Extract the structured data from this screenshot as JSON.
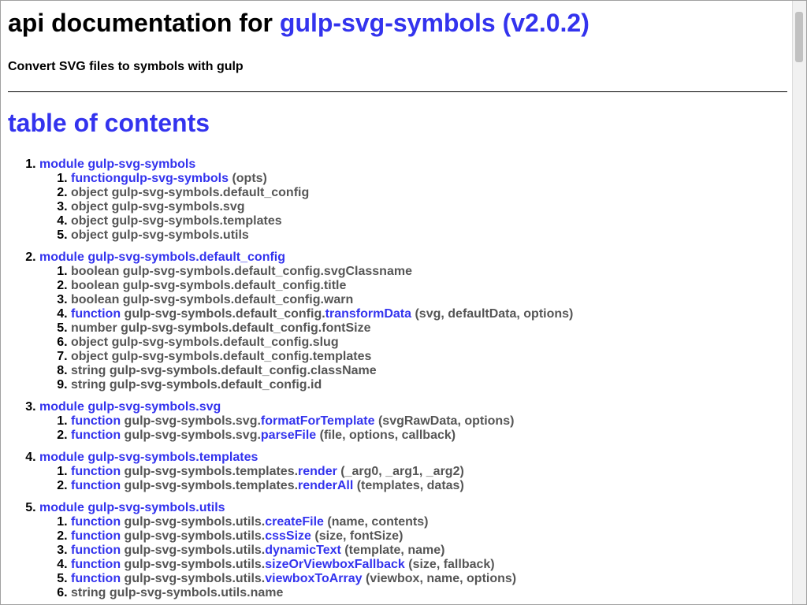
{
  "header": {
    "title_prefix": "api documentation for",
    "title_link": "gulp-svg-symbols (v2.0.2)",
    "subtitle": "Convert SVG files to symbols with gulp"
  },
  "toc": {
    "heading": "table of contents",
    "modules": [
      {
        "label": "module gulp-svg-symbols",
        "items": [
          {
            "type": "function",
            "prefix": "",
            "name": "gulp-svg-symbols",
            "args": " (opts)"
          },
          {
            "type": "",
            "prefix": "object gulp-svg-symbols.default_config",
            "name": "",
            "args": ""
          },
          {
            "type": "",
            "prefix": "object gulp-svg-symbols.svg",
            "name": "",
            "args": ""
          },
          {
            "type": "",
            "prefix": "object gulp-svg-symbols.templates",
            "name": "",
            "args": ""
          },
          {
            "type": "",
            "prefix": "object gulp-svg-symbols.utils",
            "name": "",
            "args": ""
          }
        ]
      },
      {
        "label": "module gulp-svg-symbols.default_config",
        "items": [
          {
            "type": "",
            "prefix": "boolean gulp-svg-symbols.default_config.svgClassname",
            "name": "",
            "args": ""
          },
          {
            "type": "",
            "prefix": "boolean gulp-svg-symbols.default_config.title",
            "name": "",
            "args": ""
          },
          {
            "type": "",
            "prefix": "boolean gulp-svg-symbols.default_config.warn",
            "name": "",
            "args": ""
          },
          {
            "type": "function",
            "prefix": " gulp-svg-symbols.default_config.",
            "name": "transformData",
            "args": " (svg, defaultData, options)"
          },
          {
            "type": "",
            "prefix": "number gulp-svg-symbols.default_config.fontSize",
            "name": "",
            "args": ""
          },
          {
            "type": "",
            "prefix": "object gulp-svg-symbols.default_config.slug",
            "name": "",
            "args": ""
          },
          {
            "type": "",
            "prefix": "object gulp-svg-symbols.default_config.templates",
            "name": "",
            "args": ""
          },
          {
            "type": "",
            "prefix": "string gulp-svg-symbols.default_config.className",
            "name": "",
            "args": ""
          },
          {
            "type": "",
            "prefix": "string gulp-svg-symbols.default_config.id",
            "name": "",
            "args": ""
          }
        ]
      },
      {
        "label": "module gulp-svg-symbols.svg",
        "items": [
          {
            "type": "function",
            "prefix": " gulp-svg-symbols.svg.",
            "name": "formatForTemplate",
            "args": " (svgRawData, options)"
          },
          {
            "type": "function",
            "prefix": " gulp-svg-symbols.svg.",
            "name": "parseFile",
            "args": " (file, options, callback)"
          }
        ]
      },
      {
        "label": "module gulp-svg-symbols.templates",
        "items": [
          {
            "type": "function",
            "prefix": " gulp-svg-symbols.templates.",
            "name": "render",
            "args": " (_arg0, _arg1, _arg2)"
          },
          {
            "type": "function",
            "prefix": " gulp-svg-symbols.templates.",
            "name": "renderAll",
            "args": " (templates, datas)"
          }
        ]
      },
      {
        "label": "module gulp-svg-symbols.utils",
        "items": [
          {
            "type": "function",
            "prefix": " gulp-svg-symbols.utils.",
            "name": "createFile",
            "args": " (name, contents)"
          },
          {
            "type": "function",
            "prefix": " gulp-svg-symbols.utils.",
            "name": "cssSize",
            "args": " (size, fontSize)"
          },
          {
            "type": "function",
            "prefix": " gulp-svg-symbols.utils.",
            "name": "dynamicText",
            "args": " (template, name)"
          },
          {
            "type": "function",
            "prefix": " gulp-svg-symbols.utils.",
            "name": "sizeOrViewboxFallback",
            "args": " (size, fallback)"
          },
          {
            "type": "function",
            "prefix": " gulp-svg-symbols.utils.",
            "name": "viewboxToArray",
            "args": " (viewbox, name, options)"
          },
          {
            "type": "",
            "prefix": "string gulp-svg-symbols.utils.name",
            "name": "",
            "args": ""
          }
        ]
      }
    ]
  },
  "colors": {
    "link": "#3333ee",
    "muted": "#555555"
  }
}
